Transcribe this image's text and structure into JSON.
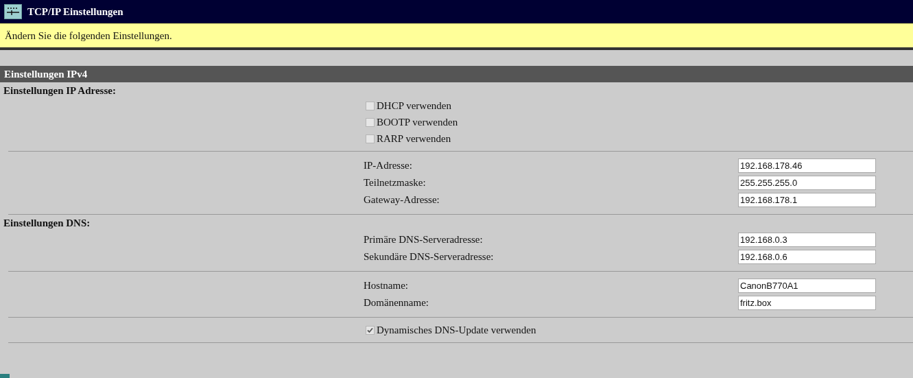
{
  "window": {
    "title": "TCP/IP Einstellungen"
  },
  "notice": "Ändern Sie die folgenden Einstellungen.",
  "panel": {
    "title": "Einstellungen IPv4",
    "sections": [
      {
        "heading": "Einstellungen IP Adresse:",
        "blocks": [
          {
            "kind": "checks",
            "items": [
              {
                "label": "DHCP verwenden",
                "checked": false
              },
              {
                "label": "BOOTP verwenden",
                "checked": false
              },
              {
                "label": "RARP verwenden",
                "checked": false
              }
            ]
          },
          {
            "kind": "fields",
            "items": [
              {
                "label": "IP-Adresse:",
                "value": "192.168.178.46"
              },
              {
                "label": "Teilnetzmaske:",
                "value": "255.255.255.0"
              },
              {
                "label": "Gateway-Adresse:",
                "value": "192.168.178.1"
              }
            ]
          }
        ]
      },
      {
        "heading": "Einstellungen DNS:",
        "blocks": [
          {
            "kind": "fields",
            "items": [
              {
                "label": "Primäre DNS-Serveradresse:",
                "value": "192.168.0.3"
              },
              {
                "label": "Sekundäre DNS-Serveradresse:",
                "value": "192.168.0.6"
              }
            ]
          },
          {
            "kind": "fields",
            "items": [
              {
                "label": "Hostname:",
                "value": "CanonB770A1"
              },
              {
                "label": "Domänenname:",
                "value": "fritz.box"
              }
            ]
          },
          {
            "kind": "checks",
            "items": [
              {
                "label": "Dynamisches DNS-Update verwenden",
                "checked": true
              }
            ]
          }
        ]
      }
    ]
  }
}
